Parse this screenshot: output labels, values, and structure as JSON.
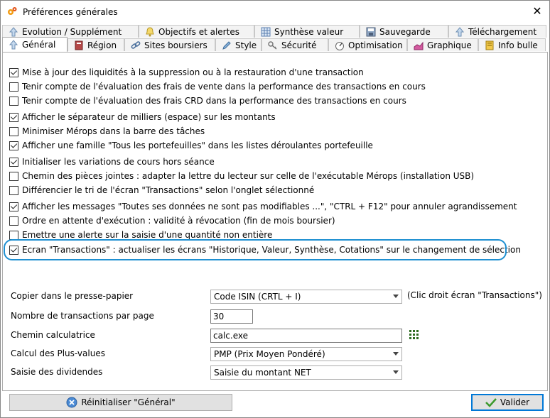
{
  "window": {
    "title": "Préférences générales",
    "close_glyph": "✕"
  },
  "tabs_top": [
    {
      "label": "Evolution / Supplément",
      "icon": "arrow-up-icon"
    },
    {
      "label": "Objectifs et alertes",
      "icon": "bell-icon"
    },
    {
      "label": "Synthèse valeur",
      "icon": "grid-icon"
    },
    {
      "label": "Sauvegarde",
      "icon": "disk-icon"
    },
    {
      "label": "Téléchargement",
      "icon": "arrow-up-icon"
    }
  ],
  "tabs_bottom": [
    {
      "label": "Général",
      "icon": "arrow-up-icon",
      "active": true
    },
    {
      "label": "Région",
      "icon": "book-icon"
    },
    {
      "label": "Sites boursiers",
      "icon": "link-icon"
    },
    {
      "label": "Style",
      "icon": "pen-icon"
    },
    {
      "label": "Sécurité",
      "icon": "key-icon"
    },
    {
      "label": "Optimisation",
      "icon": "gauge-icon"
    },
    {
      "label": "Graphique",
      "icon": "chart-icon"
    },
    {
      "label": "Info bulle",
      "icon": "info-icon"
    }
  ],
  "options": [
    {
      "label": "Mise à jour des liquidités à la suppression ou à la restauration d'une transaction",
      "checked": true
    },
    {
      "label": "Tenir compte de l'évaluation des frais de vente dans la performance des transactions en cours",
      "checked": false
    },
    {
      "label": "Tenir compte de l'évaluation des frais CRD dans la performance des transactions en cours",
      "checked": false
    },
    {
      "label": "Afficher le séparateur de milliers (espace) sur les montants",
      "checked": true
    },
    {
      "label": "Minimiser Mérops dans la barre des tâches",
      "checked": false
    },
    {
      "label": "Afficher une famille \"Tous les portefeuilles\" dans les listes déroulantes portefeuille",
      "checked": true
    },
    {
      "label": "Initialiser les variations de cours hors séance",
      "checked": true
    },
    {
      "label": "Chemin des pièces jointes : adapter la lettre du lecteur sur celle de l'exécutable Mérops (installation USB)",
      "checked": false
    },
    {
      "label": "Différencier le tri de l'écran \"Transactions\" selon l'onglet sélectionné",
      "checked": false
    },
    {
      "label": "Afficher les messages \"Toutes ses données ne sont pas modifiables ...\", \"CTRL + F12\" pour annuler agrandissement",
      "checked": true
    },
    {
      "label": "Ordre en attente d'exécution : validité à révocation (fin de mois boursier)",
      "checked": false
    },
    {
      "label": "Emettre une alerte sur la saisie d'une quantité non entière",
      "checked": false
    },
    {
      "label": "Ecran \"Transactions\" : actualiser les écrans \"Historique, Valeur, Synthèse, Cotations\" sur le changement de sélection",
      "checked": true
    }
  ],
  "fields": {
    "clipboard_label": "Copier dans le presse-papier",
    "clipboard_value": "Code ISIN (CRTL + I)",
    "clipboard_hint": "(Clic droit écran \"Transactions\")",
    "tx_per_page_label": "Nombre de transactions par page",
    "tx_per_page_value": "30",
    "calc_path_label": "Chemin calculatrice",
    "calc_path_value": "calc.exe",
    "gains_label": "Calcul des Plus-values",
    "gains_value": "PMP (Prix Moyen Pondéré)",
    "dividends_label": "Saisie des dividendes",
    "dividends_value": "Saisie du montant NET"
  },
  "buttons": {
    "reset_label": "Réinitialiser \"Général\"",
    "validate_label": "Valider"
  }
}
